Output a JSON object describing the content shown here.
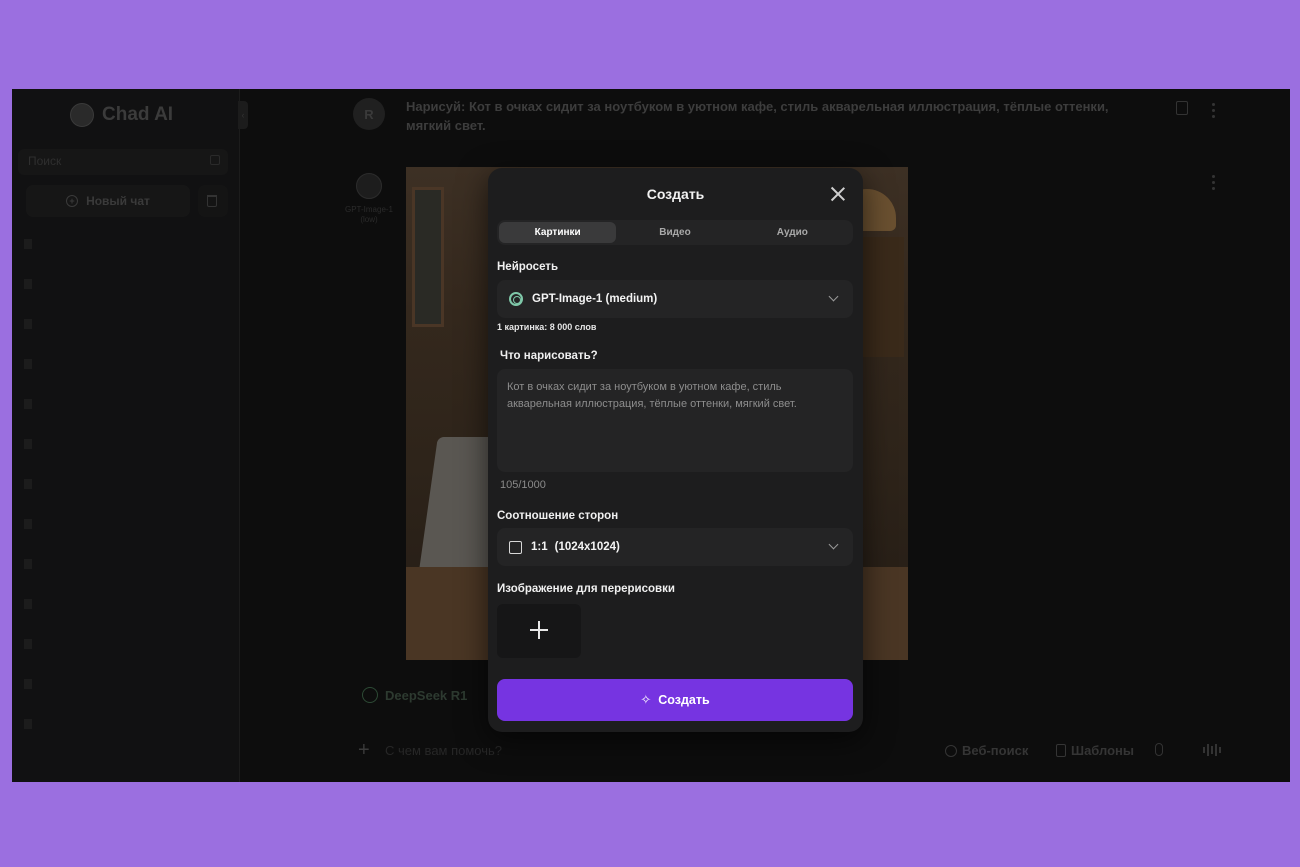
{
  "brand": {
    "name": "Chad AI"
  },
  "sidebar": {
    "search_placeholder": "Поиск",
    "new_chat_label": "Новый чат"
  },
  "chat": {
    "user_avatar_letter": "R",
    "prompt_text": "Нарисуй: Кот в очках сидит за ноутбуком в уютном кафе, стиль акварельная иллюстрация, тёплые оттенки, мягкий свет.",
    "bot_model_label": "GPT-Image-1 (low)"
  },
  "composer": {
    "model_name": "DeepSeek R1",
    "input_placeholder": "С чем вам помочь?",
    "web_search_label": "Веб-поиск",
    "templates_label": "Шаблоны"
  },
  "modal": {
    "title": "Создать",
    "tabs": [
      {
        "label": "Картинки",
        "active": true
      },
      {
        "label": "Видео",
        "active": false
      },
      {
        "label": "Аудио",
        "active": false
      }
    ],
    "model_section_label": "Нейросеть",
    "model_selected": "GPT-Image-1 (medium)",
    "model_cost_hint": "1 картинка: 8 000 слов",
    "prompt_label": "Что нарисовать?",
    "prompt_value": "Кот в очках сидит за ноутбуком в уютном кафе, стиль акварельная иллюстрация, тёплые оттенки, мягкий свет.",
    "char_counter": "105/1000",
    "aspect_label": "Соотношение сторон",
    "aspect_ratio": "1:1",
    "aspect_size": "(1024x1024)",
    "redraw_label": "Изображение для перерисовки",
    "submit_label": "Создать"
  },
  "colors": {
    "page_background": "#9b6fe0",
    "accent": "#7634e1",
    "modal_background": "#1d1d1e"
  }
}
